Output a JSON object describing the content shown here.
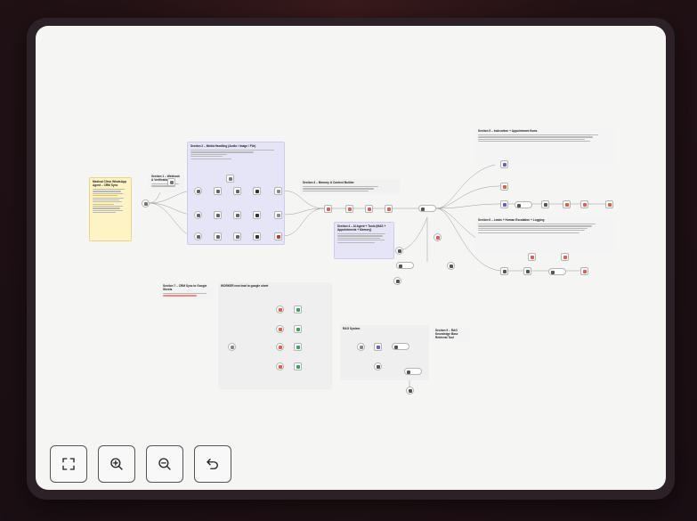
{
  "window": {
    "title": ""
  },
  "sections": [
    {
      "id": "s0",
      "title": "Medical Clinic WhatsApp Agent – CRM Sync"
    },
    {
      "id": "s1",
      "title": "Section 1 – Webhook & Verification"
    },
    {
      "id": "s2",
      "title": "Section 2 – Media Handling (Audio / Image / File)"
    },
    {
      "id": "s3",
      "title": "Section 3 – Memory & Context Builder"
    },
    {
      "id": "s4",
      "title": "Section 4 – AI Agent + Tools (MAS + Appointments + Memory)"
    },
    {
      "id": "s5",
      "title": "Section 5 – Instruction + Appointment flows"
    },
    {
      "id": "s6",
      "title": "Section 6 – Leads + Human Escalation + Logging"
    },
    {
      "id": "s7",
      "title": "Section 7 – CRM Sync to Google Sheets"
    },
    {
      "id": "s8",
      "title": "WORKER new lead to google sheet"
    },
    {
      "id": "s9",
      "title": "RAG System"
    },
    {
      "id": "s10",
      "title": "Section 9 – RAG Knowledge Base Retrieval Tool"
    }
  ],
  "controls": {
    "fit_view": "fit-view",
    "zoom_in": "zoom-in",
    "zoom_out": "zoom-out",
    "undo": "undo"
  },
  "colors": {
    "canvas": "#f5f5f4",
    "yellow_note": "#fdf3c4",
    "purple_note": "#e6e4f7",
    "gray_note": "#ececec",
    "accent_red": "#e8594f",
    "accent_green": "#3aa65c"
  }
}
